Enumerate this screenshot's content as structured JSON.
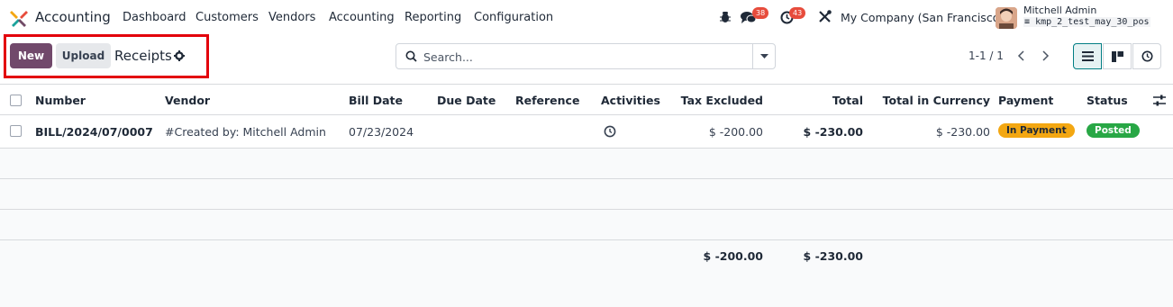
{
  "app": {
    "name": "Accounting"
  },
  "menu": [
    "Dashboard",
    "Customers",
    "Vendors",
    "Accounting",
    "Reporting",
    "Configuration"
  ],
  "systray": {
    "messages_count": "38",
    "activities_count": "43",
    "company": "My Company (San Francisco)"
  },
  "user": {
    "name": "Mitchell Admin",
    "database": "kmp_2_test_may_30_pos"
  },
  "control": {
    "new_label": "New",
    "upload_label": "Upload",
    "breadcrumb": "Receipts",
    "search_placeholder": "Search...",
    "pager": "1-1 / 1"
  },
  "table": {
    "columns": [
      "Number",
      "Vendor",
      "Bill Date",
      "Due Date",
      "Reference",
      "Activities",
      "Tax Excluded",
      "Total",
      "Total in Currency",
      "Payment",
      "Status"
    ],
    "rows": [
      {
        "number": "BILL/2024/07/0007",
        "vendor": "#Created by: Mitchell Admin",
        "bill_date": "07/23/2024",
        "due_date": "",
        "reference": "",
        "tax_excluded": "$ -200.00",
        "total": "$ -230.00",
        "total_currency": "$ -230.00",
        "payment": "In Payment",
        "status": "Posted"
      }
    ],
    "footer": {
      "tax_excluded": "$ -200.00",
      "total": "$ -230.00"
    }
  },
  "colors": {
    "brand": "#71496b",
    "payment_badge": "#f3a712",
    "status_badge": "#28a745",
    "highlight": "#e3000b"
  }
}
